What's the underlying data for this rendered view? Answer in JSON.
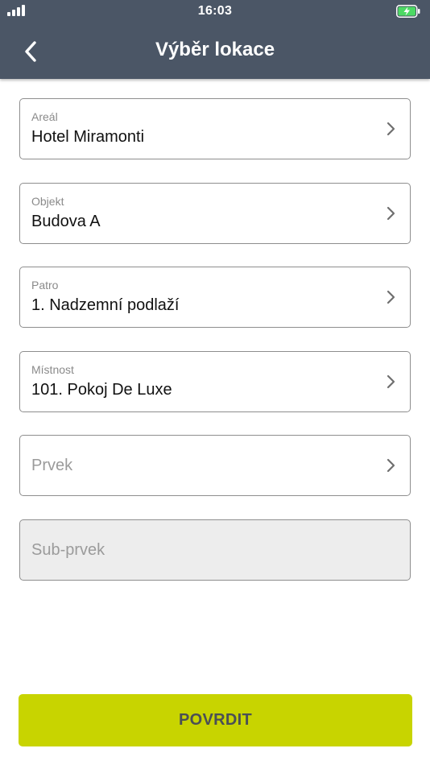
{
  "status_bar": {
    "time": "16:03",
    "signal_icon": "signal-bars-icon",
    "battery_icon": "battery-charging-icon",
    "battery_color": "#4cd964"
  },
  "nav": {
    "title": "Výběr lokace",
    "back_icon": "chevron-left-icon"
  },
  "fields": [
    {
      "label": "Areál",
      "value": "Hotel Miramonti"
    },
    {
      "label": "Objekt",
      "value": "Budova A"
    },
    {
      "label": "Patro",
      "value": "1. Nadzemní podlaží"
    },
    {
      "label": "Místnost",
      "value": "101. Pokoj De Luxe"
    },
    {
      "placeholder": "Prvek"
    },
    {
      "placeholder": "Sub-prvek",
      "disabled": true
    }
  ],
  "confirm_button": {
    "label": "POVRDIT",
    "color": "#c8d400"
  },
  "colors": {
    "header": "#4b5666",
    "field_border": "#8e8e8e",
    "disabled_field": "#ededed"
  }
}
